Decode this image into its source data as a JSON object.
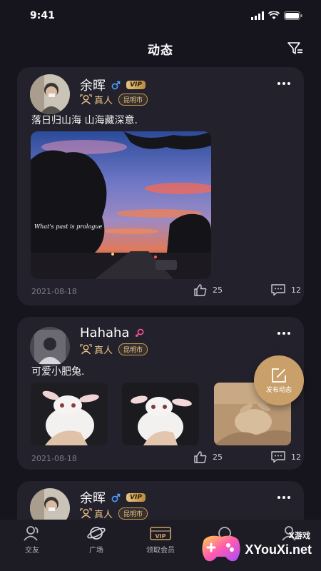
{
  "status_bar": {
    "time": "9:41"
  },
  "header": {
    "title": "动态"
  },
  "posts": [
    {
      "user": "余晖",
      "gender": "male",
      "vip": "VIP",
      "real_label": "真人",
      "city": "昆明市",
      "text": "落日归山海 山海藏深意.",
      "image_caption": "What's past is prologue",
      "date": "2021-08-18",
      "likes": "25",
      "comments": "12"
    },
    {
      "user": "Hahaha",
      "gender": "female",
      "real_label": "真人",
      "city": "昆明市",
      "text": "可爱小肥兔.",
      "date": "2021-08-18",
      "likes": "25",
      "comments": "12"
    },
    {
      "user": "余晖",
      "gender": "male",
      "vip": "VIP",
      "real_label": "真人",
      "city": "昆明市"
    }
  ],
  "fab": {
    "label": "发布动态"
  },
  "tabs": [
    {
      "label": "交友",
      "icon": "friends-icon"
    },
    {
      "label": "广场",
      "icon": "planet-icon"
    },
    {
      "label": "领取会员",
      "icon": "vip-icon",
      "badge": "VIP"
    },
    {
      "label": "",
      "icon": "message-icon"
    },
    {
      "label": "",
      "icon": "profile-icon"
    }
  ],
  "watermark": {
    "small": "X游戏",
    "big": "XYouXi.net"
  },
  "colors": {
    "gold": "#c9a06a",
    "male": "#4a9cff",
    "female": "#ff4fa0",
    "card": "#23212b"
  }
}
